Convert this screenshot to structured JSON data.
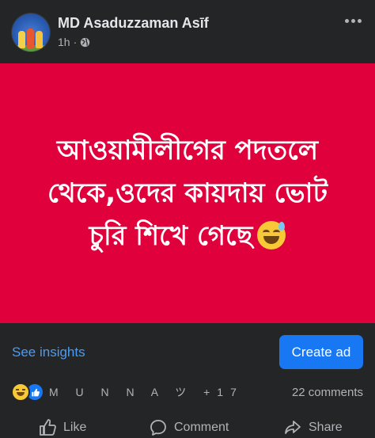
{
  "post": {
    "author": "MD Asaduzzaman Asīf",
    "time": "1h",
    "separator": "·",
    "audience_icon": "globe-icon",
    "more_icon": "more-options-icon"
  },
  "image": {
    "background_color": "#e0003c",
    "text_line1": "আওয়ামীলীগের পদতলে",
    "text_line2": "থেকে,ওদের কায়দায় ভোট",
    "text_line3": "চুরি শিখে গেছে",
    "emoji_icon": "grinning-sweat-emoji-icon"
  },
  "insights": {
    "see_insights": "See insights",
    "create_ad": "Create ad",
    "accent_color": "#1877f2"
  },
  "engagement": {
    "reactors": "M U N N A ツ +17",
    "comments": "22 comments",
    "reaction_icons": [
      "haha-reaction-icon",
      "like-reaction-icon"
    ]
  },
  "actions": {
    "like": "Like",
    "comment": "Comment",
    "share": "Share"
  }
}
